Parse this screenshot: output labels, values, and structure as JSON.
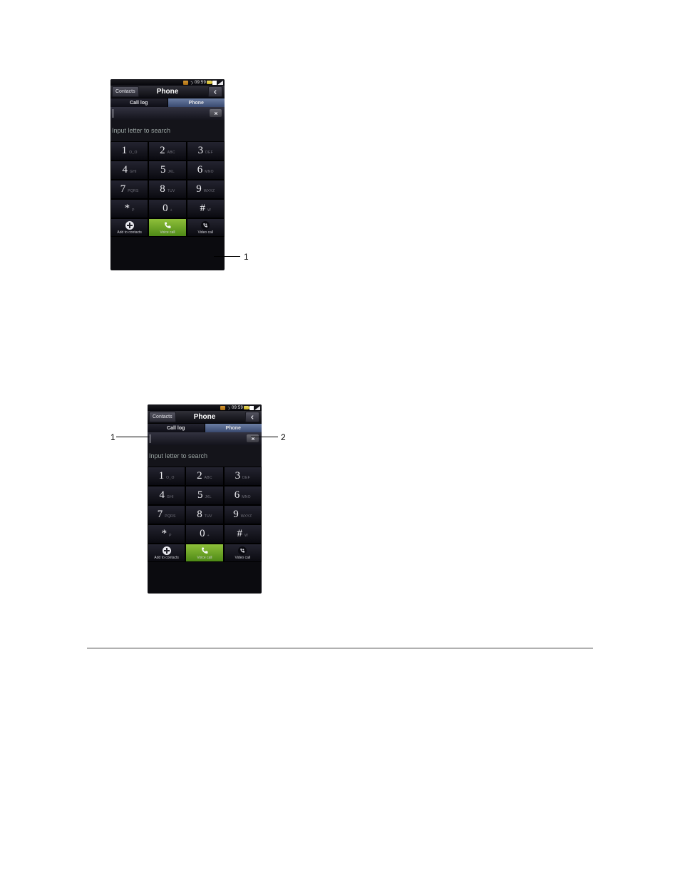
{
  "statusbar": {
    "time": "09:59"
  },
  "titlebar": {
    "contacts_label": "Contacts",
    "title": "Phone"
  },
  "tabs": {
    "call_log": "Call log",
    "phone": "Phone"
  },
  "search": {
    "hint": "Input letter to search"
  },
  "dialpad": [
    {
      "num": "1",
      "sub": "O_O"
    },
    {
      "num": "2",
      "sub": "ABC"
    },
    {
      "num": "3",
      "sub": "DEF"
    },
    {
      "num": "4",
      "sub": "GHI"
    },
    {
      "num": "5",
      "sub": "JKL"
    },
    {
      "num": "6",
      "sub": "MNO"
    },
    {
      "num": "7",
      "sub": "PQRS"
    },
    {
      "num": "8",
      "sub": "TUV"
    },
    {
      "num": "9",
      "sub": "WXYZ"
    },
    {
      "num": "*",
      "sub": "P"
    },
    {
      "num": "0",
      "sub": "+"
    },
    {
      "num": "#",
      "sub": "W"
    }
  ],
  "actions": {
    "add": "Add to contacts",
    "voice": "Voice call",
    "video": "Video call"
  },
  "annotations": {
    "fig1_label1": "1",
    "fig2_label1": "1",
    "fig2_label2": "2"
  }
}
